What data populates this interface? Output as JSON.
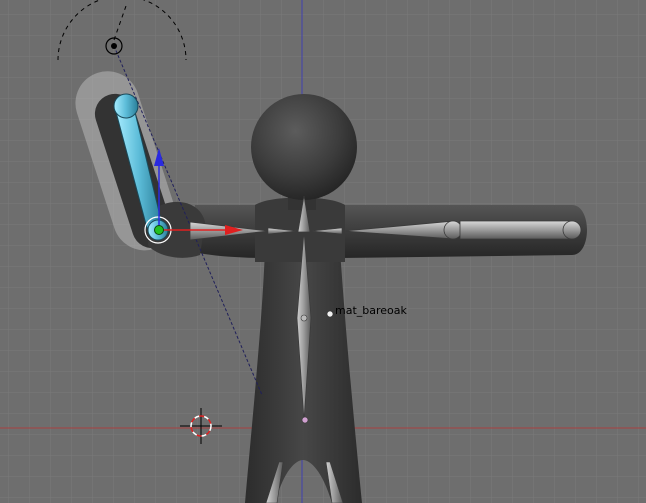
{
  "viewport": {
    "background": "#6e6e6e",
    "grid_color": "#7a7a7a",
    "x_axis_color": "#a84040",
    "z_axis_color": "#4040b0"
  },
  "object_label": "mat_bareoak",
  "icons": {
    "lamp": "lamp-icon",
    "cursor": "3d-cursor-icon",
    "manipulator": "transform-manipulator-icon"
  },
  "colors": {
    "selected_bone": "#5cbcd8",
    "selection_halo": "#b8b8b8",
    "manipulator_x": "#e02020",
    "manipulator_z": "#2a2ae0",
    "pivot": "#22c022"
  }
}
